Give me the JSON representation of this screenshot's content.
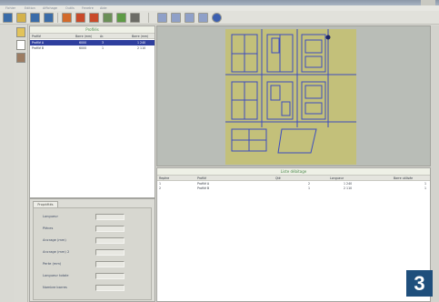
{
  "menubar": {
    "items": [
      "Fichier",
      "Edition",
      "Affichage",
      "Outils",
      "Fenetre",
      "Aide"
    ]
  },
  "toolbar": {
    "buttons": [
      {
        "icon": "back-icon",
        "color": "#3a6ca8"
      },
      {
        "icon": "folder-open-icon",
        "color": "#d4b24a"
      },
      {
        "icon": "save-icon",
        "color": "#3a6ca8"
      },
      {
        "icon": "save-as-icon",
        "color": "#3a6ca8"
      },
      {
        "icon": "warning-icon",
        "color": "#d26a2a"
      },
      {
        "icon": "alert-icon",
        "color": "#c94a2a"
      },
      {
        "icon": "settings-icon",
        "color": "#c94a2a"
      },
      {
        "icon": "grid-icon",
        "color": "#6b8f58"
      },
      {
        "icon": "green-panel-icon",
        "color": "#5d9b45"
      },
      {
        "icon": "panel-icon",
        "color": "#6c6c66"
      },
      {
        "icon": "frame-icon",
        "color": "#8fa0c8"
      },
      {
        "icon": "frame-icon",
        "color": "#8fa0c8"
      },
      {
        "icon": "frame-icon",
        "color": "#8fa0c8"
      },
      {
        "icon": "frame-icon",
        "color": "#8fa0c8"
      },
      {
        "icon": "globe-icon",
        "color": "#3b5fb0"
      }
    ]
  },
  "vtools": [
    {
      "icon": "cursor-icon",
      "color": "#e2c35a"
    },
    {
      "icon": "page-icon",
      "color": "#ffffff"
    },
    {
      "icon": "brick-icon",
      "color": "#9c7c62"
    }
  ],
  "profiles": {
    "title": "Profilés",
    "columns": [
      "Profilé",
      "Barre (mm)",
      "Ar.",
      "Barre (mm)"
    ],
    "rows": [
      [
        "Profilé A",
        "6000",
        "3",
        "1 240"
      ],
      [
        "Profilé B",
        "6000",
        "1",
        "2 110"
      ]
    ]
  },
  "properties": {
    "tab": "Propriétés",
    "rows": [
      {
        "label": "Longueur"
      },
      {
        "label": "Pièces"
      },
      {
        "label": "Ancrage (mm)"
      },
      {
        "label": "Ancrage (mm) 2"
      },
      {
        "label": "Perte (mm)"
      },
      {
        "label": "Longueur totale"
      },
      {
        "label": "Nombre barres"
      }
    ]
  },
  "canvas": {
    "board_color": "#c3c07a",
    "line_color": "#3c4dbf"
  },
  "listpanel": {
    "title": "Liste débitage",
    "columns": [
      "Repère",
      "Profilé",
      "Qté",
      "Longueur",
      "Barre utilisée"
    ],
    "rows": [
      [
        "1",
        "Profilé A",
        "2",
        "1 240",
        "1"
      ],
      [
        "2",
        "Profilé B",
        "1",
        "2 110",
        "1"
      ]
    ]
  },
  "figure_number": "3"
}
